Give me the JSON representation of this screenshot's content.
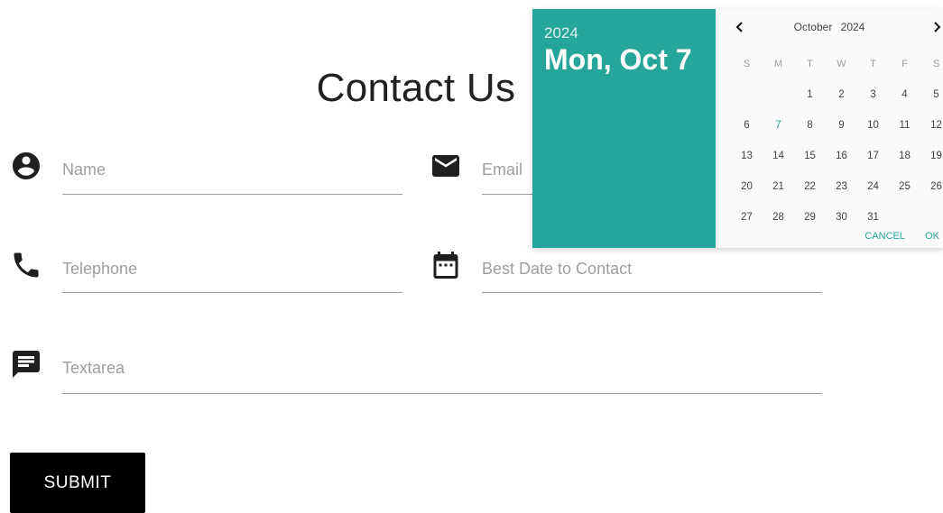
{
  "page": {
    "title": "Contact Us"
  },
  "form": {
    "name_placeholder": "Name",
    "email_placeholder": "Email",
    "telephone_placeholder": "Telephone",
    "date_placeholder": "Best Date to Contact",
    "textarea_placeholder": "Textarea",
    "submit_label": "SUBMIT"
  },
  "icons": {
    "name": "account-circle-icon",
    "email": "email-icon",
    "telephone": "phone-icon",
    "date": "calendar-icon",
    "textarea": "message-icon"
  },
  "datepicker": {
    "year": "2024",
    "selected_label": "Mon, Oct 7",
    "month": "October",
    "month_year": "2024",
    "weekdays": [
      "S",
      "M",
      "T",
      "W",
      "T",
      "F",
      "S"
    ],
    "weeks": [
      [
        "",
        "",
        "1",
        "2",
        "3",
        "4",
        "5"
      ],
      [
        "6",
        "7",
        "8",
        "9",
        "10",
        "11",
        "12"
      ],
      [
        "13",
        "14",
        "15",
        "16",
        "17",
        "18",
        "19"
      ],
      [
        "20",
        "21",
        "22",
        "23",
        "24",
        "25",
        "26"
      ],
      [
        "27",
        "28",
        "29",
        "30",
        "31",
        "",
        ""
      ]
    ],
    "selected_day": "7",
    "cancel_label": "CANCEL",
    "ok_label": "OK"
  },
  "colors": {
    "accent": "#26a69a",
    "button_bg": "#000000",
    "placeholder": "#9e9e9e"
  }
}
